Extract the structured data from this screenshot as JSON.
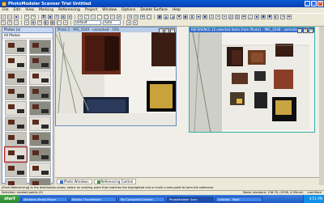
{
  "window": {
    "title": "PhotoModeler Scanner Trial Untitled"
  },
  "menu": [
    "File",
    "Edit",
    "View",
    "Marking",
    "Referencing",
    "Project",
    "Window",
    "Options",
    "Delete Surface",
    "Help"
  ],
  "toolbar": {
    "combo_mode": "Default",
    "combo_zoom": "Auto"
  },
  "photos_panel": {
    "title": "Photos (x)",
    "filter": "All Photos",
    "thumb_count": 20
  },
  "photo_windows": {
    "left_caption": "Photo 2 - IMG_0249 - unmarked - 10%",
    "right_caption": "REFERENCE 12 selected items from Photo1 - IMG_0248 - unmarked - 10%"
  },
  "tabs": [
    "Photo Windows",
    "Referencing Control"
  ],
  "hint": "[Point Referencing] In the destination photo, select an existing point that matches the highlighted one or mark a new point to form the reference.",
  "status": {
    "left": "Selection: marked points (5)",
    "middle": "Mode: standard, 138.78, (4708, 4.59mm)",
    "right": "Last Mark"
  },
  "taskbar": {
    "start": "start",
    "tasks": [
      "Windows Media Player",
      "Mozilla Thunderbird",
      "My Computer/Camera",
      "PhotoModeler Scan",
      "Untitled - Paint"
    ],
    "clock": "4:51 PM"
  }
}
